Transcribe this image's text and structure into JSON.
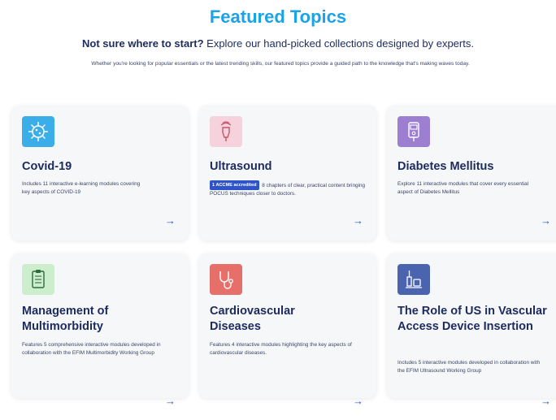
{
  "header": {
    "title": "Featured Topics",
    "subtitle_bold": "Not sure where to start?",
    "subtitle_rest": " Explore our hand-picked collections designed by experts.",
    "description": "Whether you're looking for popular essentials or the latest trending skills, our featured topics provide a guided path to the knowledge that's making waves today."
  },
  "cards": [
    {
      "title": "Covid-19",
      "description": "Includes 11 interactive e-learning modules covering key aspects of COVID-19",
      "icon": "virus-icon",
      "icon_bg": "#39aee8"
    },
    {
      "title": "Ultrasound",
      "badge": "1 ACCME accredited",
      "description": " 8 chapters of clear, practical content bringing POCUS techniques closer to doctors.",
      "icon": "ultrasound-probe-icon",
      "icon_bg": "#f6d3dc"
    },
    {
      "title": "Diabetes Mellitus",
      "description": "Explore 11 interactive modules that cover every essential aspect of Diabetes Mellitus",
      "icon": "glucose-meter-icon",
      "icon_bg": "#9c7fd0"
    },
    {
      "title": "Management of Multimorbidity",
      "description": "Features 5 comprehensive interactive modules developed in collaboration with the EFIM Multimorbidity Working Group",
      "icon": "clipboard-checklist-icon",
      "icon_bg": "#cdeecd"
    },
    {
      "title": "Cardiovascular Diseases",
      "description": "Features 4 interactive modules highlighting the key aspects of cardiovascular diseases.",
      "icon": "stethoscope-heart-icon",
      "icon_bg": "#e76f6a"
    },
    {
      "title": "The Role of US in Vascular Access Device Insertion",
      "description": "Includes 5 interactive modules developed in collaboration with the EFIM Ultrasound Working Group",
      "icon": "syringe-vial-icon",
      "icon_bg": "#4a64b0"
    }
  ],
  "arrow_glyph": "→",
  "colors": {
    "title": "#1aa3e8",
    "text": "#1c2a5e",
    "accent": "#2d55c9"
  }
}
